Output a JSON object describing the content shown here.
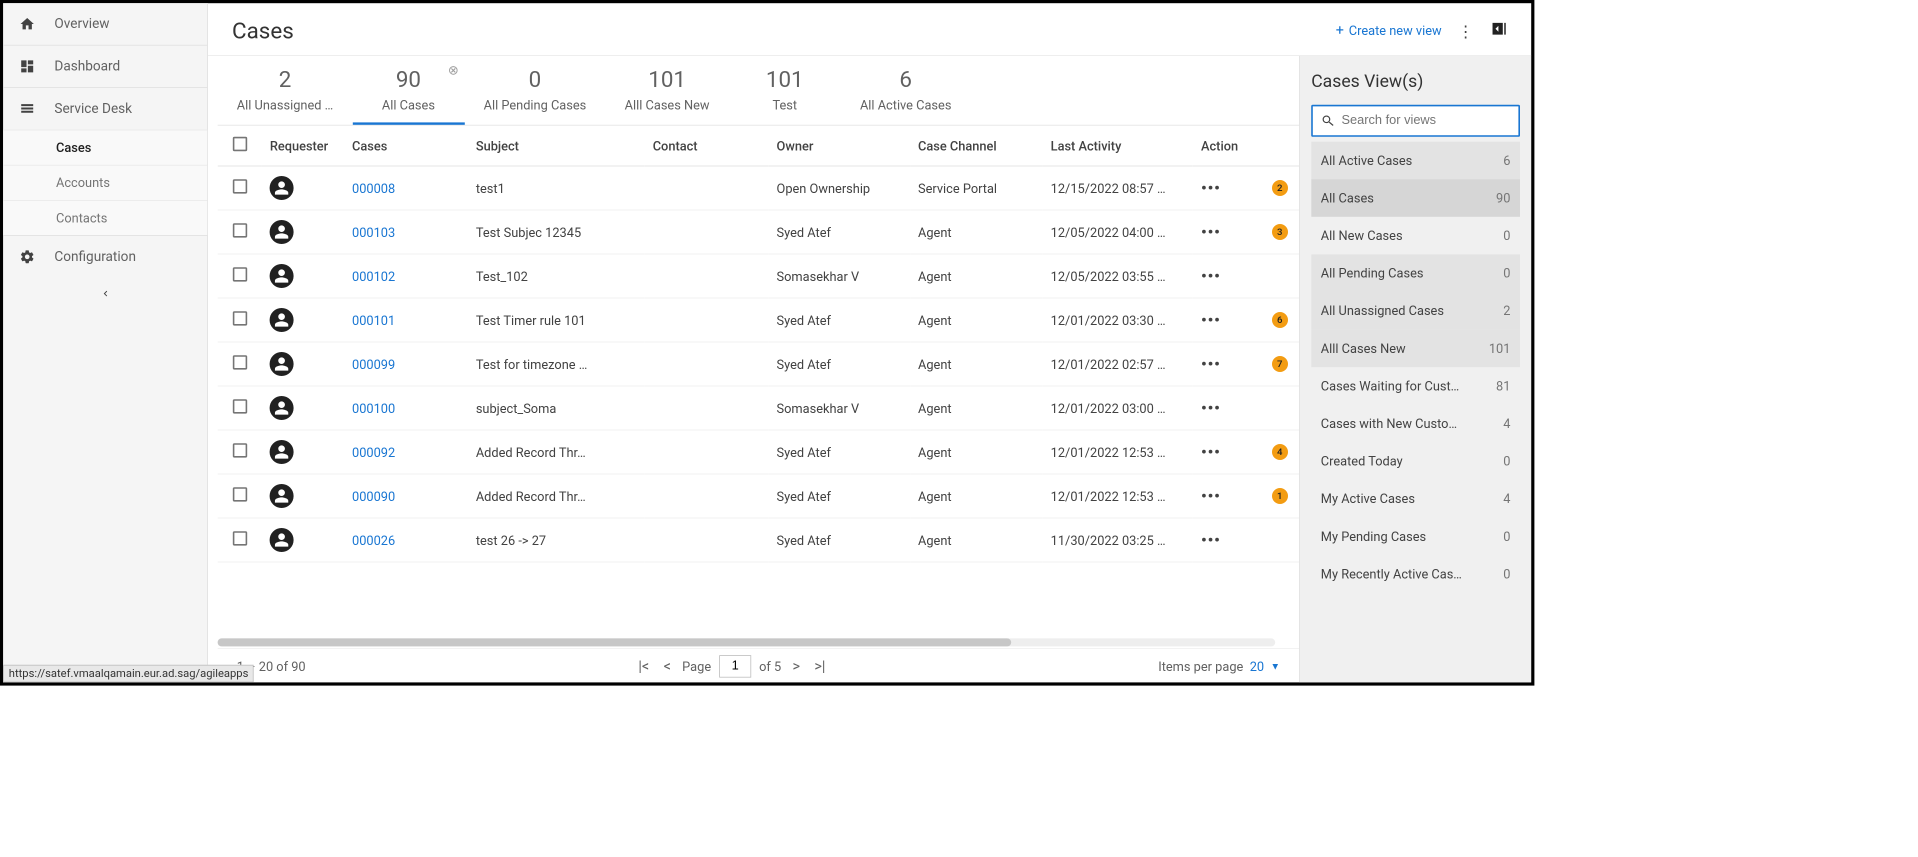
{
  "page": {
    "title": "Cases"
  },
  "header": {
    "create_label": "Create new view"
  },
  "sidebar": {
    "items": [
      {
        "icon": "home",
        "label": "Overview"
      },
      {
        "icon": "dashboard",
        "label": "Dashboard"
      },
      {
        "icon": "service",
        "label": "Service Desk"
      },
      {
        "icon": "gear",
        "label": "Configuration"
      }
    ],
    "sub": [
      {
        "label": "Cases",
        "active": true
      },
      {
        "label": "Accounts"
      },
      {
        "label": "Contacts"
      }
    ]
  },
  "tabs": [
    {
      "count": "2",
      "label": "All Unassigned …"
    },
    {
      "count": "90",
      "label": "All Cases",
      "active": true,
      "closable": true
    },
    {
      "count": "0",
      "label": "All Pending Cases"
    },
    {
      "count": "101",
      "label": "Alll Cases New"
    },
    {
      "count": "101",
      "label": "Test"
    },
    {
      "count": "6",
      "label": "All Active Cases"
    }
  ],
  "columns": {
    "requester": "Requester",
    "cases": "Cases",
    "subject": "Subject",
    "contact": "Contact",
    "owner": "Owner",
    "channel": "Case Channel",
    "activity": "Last Activity",
    "action": "Action"
  },
  "rows": [
    {
      "case": "000008",
      "subject": "test1",
      "contact": "",
      "owner": "Open Ownership",
      "channel": "Service Portal",
      "activity": "12/15/2022 08:57 …",
      "badge": "2"
    },
    {
      "case": "000103",
      "subject": "Test Subjec 12345",
      "contact": "",
      "owner": "Syed Atef",
      "channel": "Agent",
      "activity": "12/05/2022 04:00 …",
      "badge": "3"
    },
    {
      "case": "000102",
      "subject": "Test_102",
      "contact": "",
      "owner": "Somasekhar V",
      "channel": "Agent",
      "activity": "12/05/2022 03:55 …",
      "badge": ""
    },
    {
      "case": "000101",
      "subject": "Test Timer rule 101",
      "contact": "",
      "owner": "Syed Atef",
      "channel": "Agent",
      "activity": "12/01/2022 03:30 …",
      "badge": "6"
    },
    {
      "case": "000099",
      "subject": "Test for timezone …",
      "contact": "",
      "owner": "Syed Atef",
      "channel": "Agent",
      "activity": "12/01/2022 02:57 …",
      "badge": "7"
    },
    {
      "case": "000100",
      "subject": "subject_Soma",
      "contact": "",
      "owner": "Somasekhar V",
      "channel": "Agent",
      "activity": "12/01/2022 03:00 …",
      "badge": ""
    },
    {
      "case": "000092",
      "subject": "Added Record Thr…",
      "contact": "",
      "owner": "Syed Atef",
      "channel": "Agent",
      "activity": "12/01/2022 12:53 …",
      "badge": "4"
    },
    {
      "case": "000090",
      "subject": "Added Record Thr…",
      "contact": "",
      "owner": "Syed Atef",
      "channel": "Agent",
      "activity": "12/01/2022 12:53 …",
      "badge": "1"
    },
    {
      "case": "000026",
      "subject": "test 26 -> 27",
      "contact": "",
      "owner": "Syed Atef",
      "channel": "Agent",
      "activity": "11/30/2022 03:25 …",
      "badge": ""
    }
  ],
  "pagination": {
    "range": "1 – 20 of 90",
    "page_label": "Page",
    "page": "1",
    "total": "of 5",
    "ipp_label": "Items per page",
    "ipp_value": "20"
  },
  "views_panel": {
    "title": "Cases View(s)",
    "search_placeholder": "Search for views",
    "items": [
      {
        "label": "All Active Cases",
        "count": "6",
        "shaded": true
      },
      {
        "label": "All Cases",
        "count": "90",
        "shaded": true,
        "selected": true
      },
      {
        "label": "All New Cases",
        "count": "0"
      },
      {
        "label": "All Pending Cases",
        "count": "0",
        "shaded": true
      },
      {
        "label": "All Unassigned Cases",
        "count": "2",
        "shaded": true
      },
      {
        "label": "Alll Cases New",
        "count": "101",
        "shaded": true
      },
      {
        "label": "Cases Waiting for Cust…",
        "count": "81"
      },
      {
        "label": "Cases with New Custo…",
        "count": "4"
      },
      {
        "label": "Created Today",
        "count": "0"
      },
      {
        "label": "My Active Cases",
        "count": "4"
      },
      {
        "label": "My Pending Cases",
        "count": "0"
      },
      {
        "label": "My Recently Active Cas…",
        "count": "0"
      }
    ]
  },
  "status_url": "https://satef.vmaalqamain.eur.ad.sag/agileapps"
}
